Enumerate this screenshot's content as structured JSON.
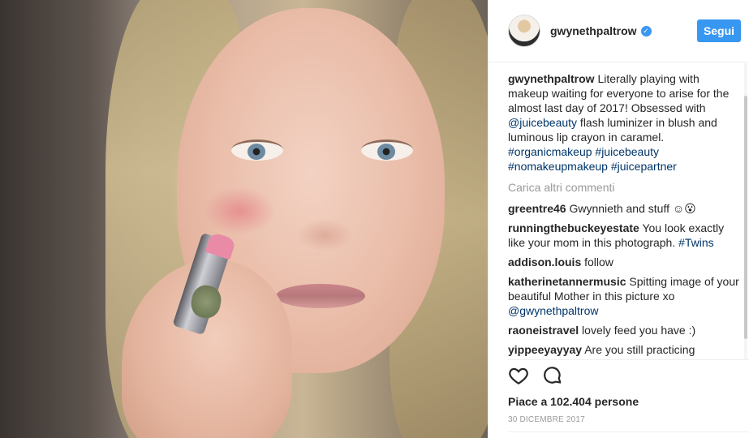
{
  "post": {
    "author": "gwynethpaltrow",
    "follow_label": "Segui",
    "caption": {
      "author": "gwynethpaltrow",
      "text_1": " Literally playing with makeup waiting for everyone to arise for the almost last day of 2017! Obsessed with ",
      "mention": "@juicebeauty",
      "text_2": " flash luminizer in blush and luminous lip crayon in caramel. ",
      "tags": [
        "#organicmakeup",
        "#juicebeauty",
        "#nomakeupmakeup",
        "#juicepartner"
      ]
    },
    "load_more": "Carica altri commenti",
    "comments": [
      {
        "user": "greentre46",
        "text": " Gwynnieth and stuff ☺😮"
      },
      {
        "user": "runningthebuckeyestate",
        "text": " You look exactly like your mom in this photograph. ",
        "tag": "#Twins"
      },
      {
        "user": "addison.louis",
        "text": " follow"
      },
      {
        "user": "katherinetannermusic",
        "text": " Spitting image of your beautiful Mother in this picture xo ",
        "tag": "@gwynethpaltrow"
      },
      {
        "user": "raoneistravel",
        "text": " lovely feed you have :)"
      },
      {
        "user": "yippeeyayyay",
        "text": " Are you still practicing"
      }
    ],
    "likes": "Piace a 102.404 persone",
    "date": "30 DICEMBRE 2017"
  },
  "icons": {
    "like": "heart-icon",
    "comment": "comment-icon",
    "verified": "verified-badge-icon"
  },
  "colors": {
    "accent": "#3897f0",
    "link": "#003569",
    "muted": "#999999"
  }
}
